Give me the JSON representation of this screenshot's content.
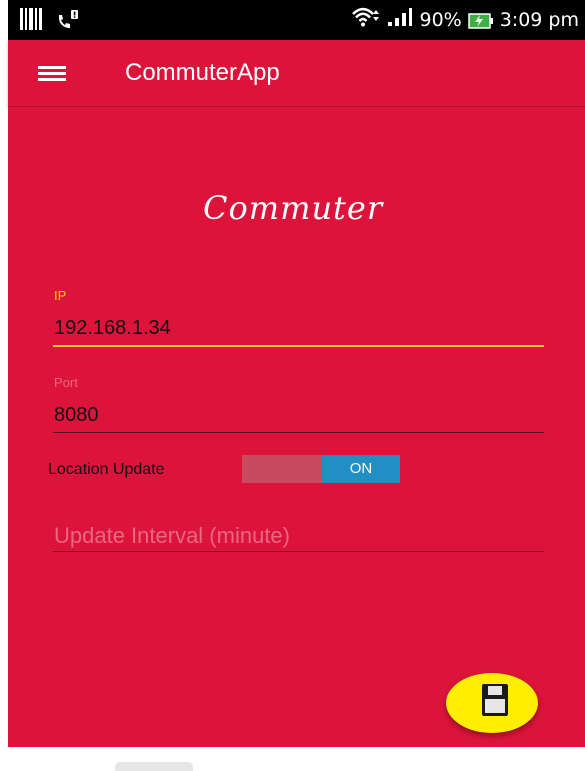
{
  "status_bar": {
    "battery": "90%",
    "time": "3:09 pm",
    "icons": [
      "barcode-icon",
      "call-alert-icon",
      "wifi-icon",
      "signal-icon",
      "battery-charging-icon"
    ]
  },
  "app_bar": {
    "title": "CommuterApp",
    "menu_icon": "menu-icon"
  },
  "logo": {
    "text": "Commuter"
  },
  "form": {
    "ip": {
      "label": "IP",
      "value": "192.168.1.34"
    },
    "port": {
      "label": "Port",
      "value": "8080"
    },
    "location_update": {
      "label": "Location Update",
      "state": "ON"
    },
    "interval": {
      "placeholder": "Update Interval (minute)"
    }
  },
  "fab": {
    "icon": "save-icon"
  },
  "colors": {
    "primary": "#dc143c",
    "accent": "#ffee00",
    "toggle_on": "#1f8fc4",
    "focused_label": "#ffd21f"
  }
}
